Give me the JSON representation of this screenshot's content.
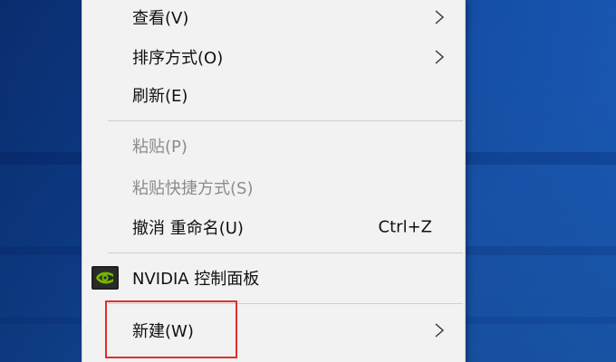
{
  "menu": {
    "items": [
      {
        "label": "查看(V)",
        "has_submenu": true,
        "enabled": true
      },
      {
        "label": "排序方式(O)",
        "has_submenu": true,
        "enabled": true
      },
      {
        "label": "刷新(E)",
        "has_submenu": false,
        "enabled": true
      },
      {
        "label": "粘贴(P)",
        "has_submenu": false,
        "enabled": false
      },
      {
        "label": "粘贴快捷方式(S)",
        "has_submenu": false,
        "enabled": false
      },
      {
        "label": "撤消 重命名(U)",
        "shortcut": "Ctrl+Z",
        "has_submenu": false,
        "enabled": true
      },
      {
        "label": "NVIDIA 控制面板",
        "icon": "nvidia-icon",
        "has_submenu": false,
        "enabled": true
      },
      {
        "label": "新建(W)",
        "has_submenu": true,
        "enabled": true,
        "highlighted": true
      }
    ]
  },
  "colors": {
    "menu_background": "#f2f2f2",
    "text": "#111111",
    "disabled_text": "#8c8c8c",
    "highlight_box": "#e0302a",
    "nvidia_green": "#76b900",
    "desktop_blue": "#1550a8"
  }
}
